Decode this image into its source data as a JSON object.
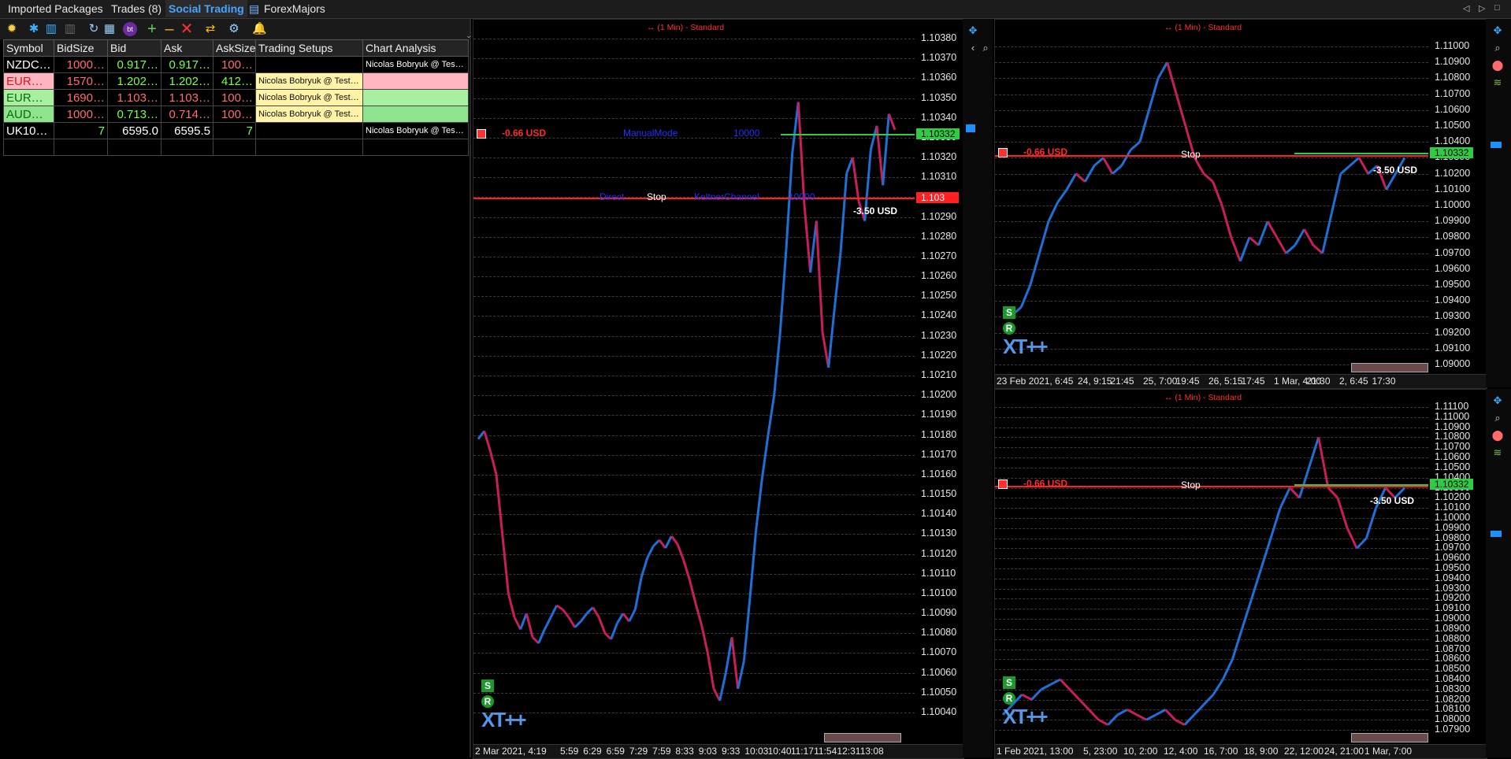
{
  "tabs": [
    {
      "label": "Imported Packages"
    },
    {
      "label": "Trades (8)"
    },
    {
      "label": "Social Trading"
    },
    {
      "label": "ForexMajors"
    }
  ],
  "window_controls": [
    "◁",
    "▷",
    "□"
  ],
  "grid": {
    "headers": [
      "Symbol",
      "BidSize",
      "Bid",
      "Ask",
      "AskSize",
      "Trading Setups",
      "Chart Analysis"
    ],
    "rows": [
      {
        "symbol": "NZDC…",
        "bidsize": "1000…",
        "bid": "0.917…",
        "ask": "0.917…",
        "asksize": "100…",
        "setups": "",
        "analysis": "Nicolas Bobryuk @ Test…",
        "bg": "#000000",
        "symcolor": "#ffffff",
        "bidsizecolor": "#ff6e6e",
        "bidcolor": "#7cff4a",
        "askcolor": "#7cff4a",
        "asksizecolor": "#ff6e6e",
        "setupbg": "#000000",
        "analysisbg": "#000000",
        "analysiscolor": "#ffffff"
      },
      {
        "symbol": "EURU…",
        "bidsize": "1570…",
        "bid": "1.202…",
        "ask": "1.202…",
        "asksize": "412…",
        "setups": "Nicolas Bobryuk @ Test…",
        "analysis": "",
        "bg": "#ffb6c1",
        "symcolor": "#d11b1b",
        "bidsizecolor": "#ff6e6e",
        "bidcolor": "#7cff4a",
        "askcolor": "#7cff4a",
        "asksizecolor": "#7cff4a",
        "setupbg": "#fff3a8",
        "analysisbg": "#ffb6c1",
        "analysiscolor": "#111111"
      },
      {
        "symbol": "EURCHF",
        "bidsize": "1690…",
        "bid": "1.103…",
        "ask": "1.103…",
        "asksize": "100…",
        "setups": "Nicolas Bobryuk @ Test…",
        "analysis": "",
        "bg": "#a8f0a0",
        "symcolor": "#0a6b0a",
        "bidsizecolor": "#ff6e6e",
        "bidcolor": "#ff6e6e",
        "askcolor": "#ff6e6e",
        "asksizecolor": "#ff6e6e",
        "setupbg": "#fff3a8",
        "analysisbg": "#a8f0a0",
        "analysiscolor": "#111111"
      },
      {
        "symbol": "AUDC…",
        "bidsize": "1000…",
        "bid": "0.713…",
        "ask": "0.714…",
        "asksize": "100…",
        "setups": "Nicolas Bobryuk @ Test…",
        "analysis": "",
        "bg": "#8de48d",
        "symcolor": "#0a6b0a",
        "bidsizecolor": "#ff6e6e",
        "bidcolor": "#7cff4a",
        "askcolor": "#ff6e6e",
        "asksizecolor": "#ff6e6e",
        "setupbg": "#fff3a8",
        "analysisbg": "#8de48d",
        "analysiscolor": "#111111"
      },
      {
        "symbol": "UK10…",
        "bidsize": "7",
        "bid": "6595.0",
        "ask": "6595.5",
        "asksize": "7",
        "setups": "",
        "analysis": "Nicolas Bobryuk @ Test…",
        "bg": "#000000",
        "symcolor": "#ffffff",
        "bidsizecolor": "#7cff4a",
        "bidcolor": "#ffffff",
        "askcolor": "#ffffff",
        "asksizecolor": "#7cff4a",
        "setupbg": "#000000",
        "analysisbg": "#000000",
        "analysiscolor": "#ffffff"
      },
      {
        "symbol": "",
        "bidsize": "",
        "bid": "",
        "ask": "",
        "asksize": "",
        "setups": "",
        "analysis": "",
        "bg": "#000000",
        "symcolor": "#ffffff",
        "bidsizecolor": "#ffffff",
        "bidcolor": "#ffffff",
        "askcolor": "#ffffff",
        "asksizecolor": "#ffffff",
        "setupbg": "#000000",
        "analysisbg": "#000000",
        "analysiscolor": "#ffffff"
      }
    ]
  },
  "toolbar_icons": [
    "sun-icon",
    "grid-icon",
    "chart-icon",
    "chart-muted-icon",
    "refresh-icon",
    "chart-alt-icon",
    "badge-icon",
    "add-icon",
    "minus-icon",
    "close-icon",
    "trade-icon",
    "settings-icon",
    "bell-icon"
  ],
  "charts": [
    {
      "id": "main",
      "title": "↔ (1 Min) - Standard",
      "prices": [
        "1.10380",
        "1.10370",
        "1.10360",
        "1.10350",
        "1.10340",
        "1.10330",
        "1.10320",
        "1.10310",
        "1.10300",
        "1.10290",
        "1.10280",
        "1.10270",
        "1.10260",
        "1.10250",
        "1.10240",
        "1.10230",
        "1.10220",
        "1.10210",
        "1.10200",
        "1.10190",
        "1.10180",
        "1.10170",
        "1.10160",
        "1.10150",
        "1.10140",
        "1.10130",
        "1.10120",
        "1.10110",
        "1.10100",
        "1.10090",
        "1.10080",
        "1.10070",
        "1.10060",
        "1.10050",
        "1.10040"
      ],
      "times": [
        "2 Mar 2021, 4:19",
        "5:59",
        "6:29",
        "6:59",
        "7:29",
        "7:59",
        "8:33",
        "9:03",
        "9:33",
        "10:03",
        "10:40",
        "11:17",
        "11:54",
        "12:31",
        "13:08"
      ],
      "pl_label": "-0.66 USD",
      "manual_label": "ManualMode",
      "qty_label": "10000",
      "direct_label": "Direct",
      "stop_label": "Stop",
      "kc_label": "KeltnerChannel",
      "qty2_label": "10000",
      "loss_label": "-3.50 USD",
      "ask_tag": "1.10332",
      "stop_tag": "1.103",
      "badges": [
        "S",
        "R"
      ],
      "logo": "XT++",
      "series": [
        1.10178,
        1.10182,
        1.10172,
        1.1016,
        1.1013,
        1.101,
        1.10088,
        1.10082,
        1.1009,
        1.10078,
        1.10075,
        1.10082,
        1.10088,
        1.10094,
        1.10092,
        1.10088,
        1.10083,
        1.10086,
        1.1009,
        1.10093,
        1.10088,
        1.1008,
        1.10077,
        1.10085,
        1.1009,
        1.10086,
        1.10092,
        1.10108,
        1.10118,
        1.10124,
        1.10127,
        1.10123,
        1.10129,
        1.10125,
        1.10117,
        1.10107,
        1.10095,
        1.10084,
        1.1007,
        1.10052,
        1.10046,
        1.1006,
        1.10078,
        1.10052,
        1.10066,
        1.10098,
        1.10132,
        1.10158,
        1.1018,
        1.102,
        1.10232,
        1.10274,
        1.10322,
        1.10348,
        1.10296,
        1.10262,
        1.10288,
        1.10232,
        1.10214,
        1.10244,
        1.10272,
        1.10312,
        1.1032,
        1.10298,
        1.10288,
        1.10324,
        1.10336,
        1.10306,
        1.10342,
        1.10334
      ]
    },
    {
      "id": "topright",
      "title": "↔ (1 Min) - Standard",
      "prices": [
        "1.11000",
        "1.10900",
        "1.10800",
        "1.10700",
        "1.10600",
        "1.10500",
        "1.10400",
        "1.10300",
        "1.10200",
        "1.10100",
        "1.10000",
        "1.09900",
        "1.09800",
        "1.09700",
        "1.09600",
        "1.09500",
        "1.09400",
        "1.09300",
        "1.09200",
        "1.09100",
        "1.09000"
      ],
      "times": [
        "23 Feb 2021, 6:45",
        "24, 9:15",
        "21:45",
        "25, 7:00",
        "19:45",
        "26, 5:15",
        "17:45",
        "1 Mar, 4:00",
        "21:30",
        "2, 6:45",
        "17:30"
      ],
      "pl_label": "-0.66 USD",
      "stop_label": "Stop",
      "loss_label": "-3.50 USD",
      "ask_tag": "1.10332",
      "badges": [
        "S",
        "R"
      ],
      "logo": "XT++",
      "series": [
        1.0934,
        1.0931,
        1.0936,
        1.095,
        1.097,
        1.099,
        1.1002,
        1.101,
        1.102,
        1.1015,
        1.1025,
        1.103,
        1.102,
        1.1025,
        1.1035,
        1.104,
        1.106,
        1.108,
        1.109,
        1.107,
        1.105,
        1.103,
        1.102,
        1.1015,
        1.1,
        1.098,
        1.0965,
        1.098,
        1.0975,
        1.099,
        1.098,
        1.097,
        1.0975,
        1.0985,
        1.0975,
        1.097,
        1.0995,
        1.102,
        1.1025,
        1.103,
        1.102,
        1.1025,
        1.101,
        1.102,
        1.103
      ]
    },
    {
      "id": "bottomright",
      "title": "↔ (1 Min) - Standard",
      "prices": [
        "1.11100",
        "1.11000",
        "1.10900",
        "1.10800",
        "1.10700",
        "1.10600",
        "1.10500",
        "1.10400",
        "1.10300",
        "1.10200",
        "1.10100",
        "1.10000",
        "1.09900",
        "1.09800",
        "1.09700",
        "1.09600",
        "1.09500",
        "1.09400",
        "1.09300",
        "1.09200",
        "1.09100",
        "1.09000",
        "1.08900",
        "1.08800",
        "1.08700",
        "1.08600",
        "1.08500",
        "1.08400",
        "1.08300",
        "1.08200",
        "1.08100",
        "1.08000",
        "1.07900"
      ],
      "times": [
        "1 Feb 2021, 13:00",
        "5, 23:00",
        "10, 2:00",
        "12, 4:00",
        "16, 7:00",
        "18, 9:00",
        "22, 12:00",
        "24, 21:00",
        "1 Mar, 7:00"
      ],
      "pl_label": "-0.66 USD",
      "stop_label": "Stop",
      "loss_label": "-3.50 USD",
      "ask_tag": "1.10332",
      "badges": [
        "S",
        "R"
      ],
      "logo": "XT++",
      "series": [
        1.0805,
        1.0815,
        1.0825,
        1.082,
        1.083,
        1.0835,
        1.084,
        1.083,
        1.082,
        1.081,
        1.08,
        1.0795,
        1.0805,
        1.081,
        1.0805,
        1.08,
        1.0805,
        1.081,
        1.08,
        1.0795,
        1.0805,
        1.0815,
        1.0825,
        1.084,
        1.086,
        1.089,
        1.092,
        1.095,
        1.098,
        1.101,
        1.103,
        1.102,
        1.105,
        1.108,
        1.103,
        1.102,
        1.099,
        1.097,
        1.098,
        1.101,
        1.103,
        1.102,
        1.103
      ]
    }
  ],
  "colors": {
    "accent": "#4aa3ff",
    "ask_line": "#2ecc40",
    "stop_line": "#ff2020",
    "candle_blue": "#1f6fd6",
    "candle_red": "#c81e5a"
  }
}
